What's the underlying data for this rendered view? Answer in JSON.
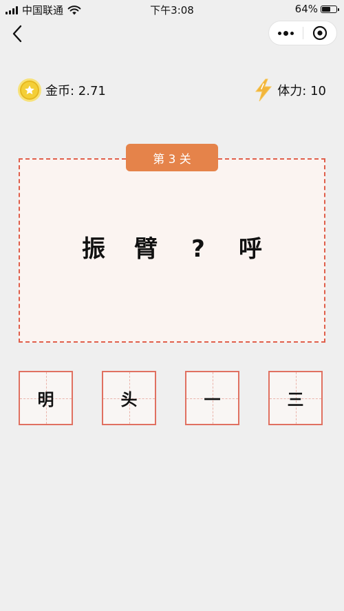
{
  "status_bar": {
    "carrier": "中国联通",
    "time": "下午3:08",
    "battery_percent": "64%",
    "battery_level": 0.64
  },
  "nav": {
    "back_icon": "chevron-left-icon",
    "more_icon": "more-dots-icon",
    "close_icon": "target-circle-icon"
  },
  "stats": {
    "coins_label": "金币: 2.71",
    "energy_label": "体力: 10"
  },
  "level": {
    "badge": "第 3 关",
    "idiom": [
      "振",
      "臂",
      "?",
      "呼"
    ]
  },
  "options": [
    "明",
    "头",
    "一",
    "三"
  ],
  "colors": {
    "accent": "#e5834a",
    "border": "#e05e4a",
    "coin": "#f4cf37",
    "bolt": "#f2b53a"
  }
}
